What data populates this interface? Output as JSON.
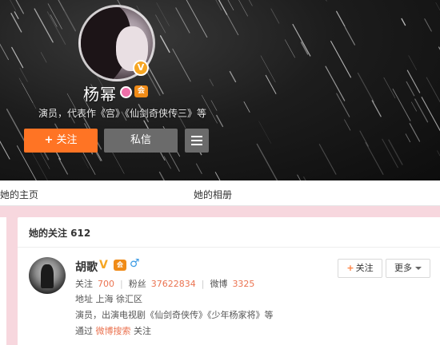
{
  "profile": {
    "name": "杨幂",
    "verified_badge": "V",
    "member_badge": "会",
    "description": "演员，代表作《宫》《仙剑奇侠传三》等",
    "follow_button": "关注",
    "follow_plus": "+",
    "message_button": "私信",
    "menu_icon": "hamburger-icon"
  },
  "tabs": [
    {
      "label": "她的主页"
    },
    {
      "label": "她的相册"
    }
  ],
  "following": {
    "title": "她的关注 612",
    "user": {
      "name": "胡歌",
      "verified": "V",
      "member_badge": "会",
      "gender_symbol": "♂",
      "stats": [
        {
          "label": "关注",
          "value": "700"
        },
        {
          "label": "粉丝",
          "value": "37622834"
        },
        {
          "label": "微博",
          "value": "3325"
        }
      ],
      "location_label": "地址",
      "location": "上海 徐汇区",
      "bio": "演员，出演电视剧《仙剑奇侠传》《少年杨家将》等",
      "via_prefix": "通过",
      "via_link": "微博搜索",
      "via_suffix": "关注",
      "follow_button": "关注",
      "follow_plus": "+",
      "more_button": "更多"
    }
  },
  "colors": {
    "accent_orange": "#ff7424",
    "link_orange": "#eb7350",
    "verified_gold": "#f6a623",
    "page_pink": "#f7d7de",
    "male_blue": "#3b9be4"
  }
}
